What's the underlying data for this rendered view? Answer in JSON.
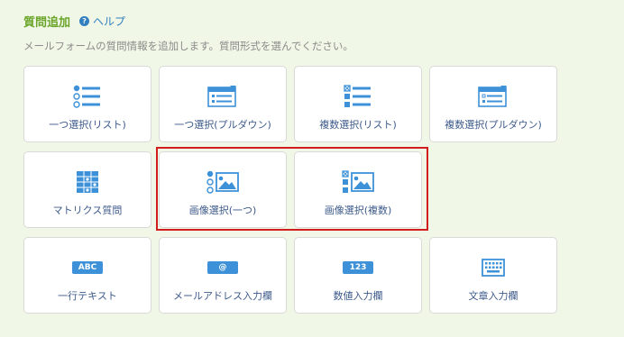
{
  "header": {
    "title": "質問追加",
    "help_label": "ヘルプ",
    "help_icon": "question-circle-icon"
  },
  "description": "メールフォームの質問情報を追加します。質問形式を選んでください。",
  "colors": {
    "accent": "#3d91d8",
    "title": "#6aa52a",
    "highlight": "#d21d1d"
  },
  "items": [
    {
      "label": "一つ選択(リスト)",
      "icon": "radio-list-icon"
    },
    {
      "label": "一つ選択(プルダウン)",
      "icon": "dropdown-icon"
    },
    {
      "label": "複数選択(リスト)",
      "icon": "checkbox-list-icon"
    },
    {
      "label": "複数選択(プルダウン)",
      "icon": "multi-dropdown-icon"
    },
    {
      "label": "マトリクス質問",
      "icon": "matrix-icon"
    },
    {
      "label": "画像選択(一つ)",
      "icon": "image-radio-icon"
    },
    {
      "label": "画像選択(複数)",
      "icon": "image-checkbox-icon"
    },
    {
      "label": "一行テキスト",
      "icon": "abc-icon",
      "badge": "ABC"
    },
    {
      "label": "メールアドレス入力欄",
      "icon": "at-icon",
      "badge": "@"
    },
    {
      "label": "数値入力欄",
      "icon": "number-icon",
      "badge": "123"
    },
    {
      "label": "文章入力欄",
      "icon": "keyboard-icon"
    }
  ]
}
